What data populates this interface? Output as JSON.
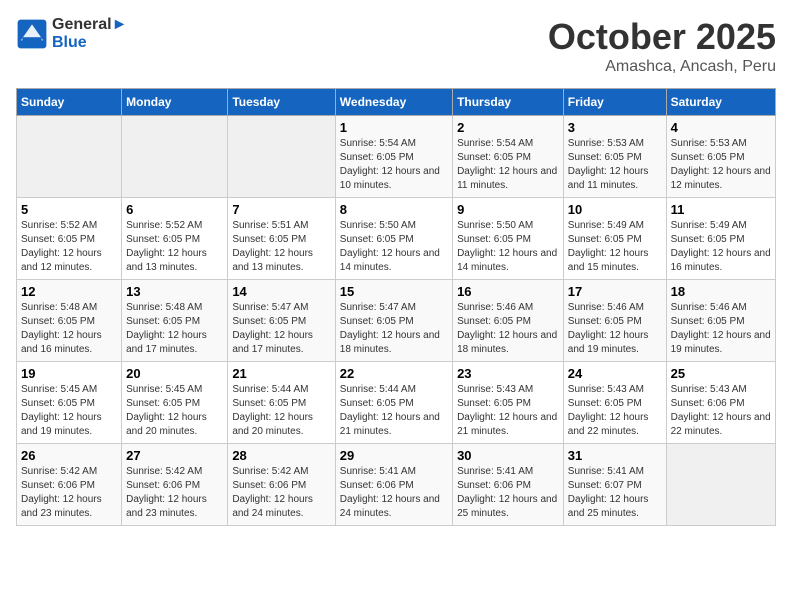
{
  "logo": {
    "line1": "General",
    "line2": "Blue"
  },
  "title": "October 2025",
  "subtitle": "Amashca, Ancash, Peru",
  "days_of_week": [
    "Sunday",
    "Monday",
    "Tuesday",
    "Wednesday",
    "Thursday",
    "Friday",
    "Saturday"
  ],
  "weeks": [
    [
      {
        "day": "",
        "sunrise": "",
        "sunset": "",
        "daylight": ""
      },
      {
        "day": "",
        "sunrise": "",
        "sunset": "",
        "daylight": ""
      },
      {
        "day": "",
        "sunrise": "",
        "sunset": "",
        "daylight": ""
      },
      {
        "day": "1",
        "sunrise": "Sunrise: 5:54 AM",
        "sunset": "Sunset: 6:05 PM",
        "daylight": "Daylight: 12 hours and 10 minutes."
      },
      {
        "day": "2",
        "sunrise": "Sunrise: 5:54 AM",
        "sunset": "Sunset: 6:05 PM",
        "daylight": "Daylight: 12 hours and 11 minutes."
      },
      {
        "day": "3",
        "sunrise": "Sunrise: 5:53 AM",
        "sunset": "Sunset: 6:05 PM",
        "daylight": "Daylight: 12 hours and 11 minutes."
      },
      {
        "day": "4",
        "sunrise": "Sunrise: 5:53 AM",
        "sunset": "Sunset: 6:05 PM",
        "daylight": "Daylight: 12 hours and 12 minutes."
      }
    ],
    [
      {
        "day": "5",
        "sunrise": "Sunrise: 5:52 AM",
        "sunset": "Sunset: 6:05 PM",
        "daylight": "Daylight: 12 hours and 12 minutes."
      },
      {
        "day": "6",
        "sunrise": "Sunrise: 5:52 AM",
        "sunset": "Sunset: 6:05 PM",
        "daylight": "Daylight: 12 hours and 13 minutes."
      },
      {
        "day": "7",
        "sunrise": "Sunrise: 5:51 AM",
        "sunset": "Sunset: 6:05 PM",
        "daylight": "Daylight: 12 hours and 13 minutes."
      },
      {
        "day": "8",
        "sunrise": "Sunrise: 5:50 AM",
        "sunset": "Sunset: 6:05 PM",
        "daylight": "Daylight: 12 hours and 14 minutes."
      },
      {
        "day": "9",
        "sunrise": "Sunrise: 5:50 AM",
        "sunset": "Sunset: 6:05 PM",
        "daylight": "Daylight: 12 hours and 14 minutes."
      },
      {
        "day": "10",
        "sunrise": "Sunrise: 5:49 AM",
        "sunset": "Sunset: 6:05 PM",
        "daylight": "Daylight: 12 hours and 15 minutes."
      },
      {
        "day": "11",
        "sunrise": "Sunrise: 5:49 AM",
        "sunset": "Sunset: 6:05 PM",
        "daylight": "Daylight: 12 hours and 16 minutes."
      }
    ],
    [
      {
        "day": "12",
        "sunrise": "Sunrise: 5:48 AM",
        "sunset": "Sunset: 6:05 PM",
        "daylight": "Daylight: 12 hours and 16 minutes."
      },
      {
        "day": "13",
        "sunrise": "Sunrise: 5:48 AM",
        "sunset": "Sunset: 6:05 PM",
        "daylight": "Daylight: 12 hours and 17 minutes."
      },
      {
        "day": "14",
        "sunrise": "Sunrise: 5:47 AM",
        "sunset": "Sunset: 6:05 PM",
        "daylight": "Daylight: 12 hours and 17 minutes."
      },
      {
        "day": "15",
        "sunrise": "Sunrise: 5:47 AM",
        "sunset": "Sunset: 6:05 PM",
        "daylight": "Daylight: 12 hours and 18 minutes."
      },
      {
        "day": "16",
        "sunrise": "Sunrise: 5:46 AM",
        "sunset": "Sunset: 6:05 PM",
        "daylight": "Daylight: 12 hours and 18 minutes."
      },
      {
        "day": "17",
        "sunrise": "Sunrise: 5:46 AM",
        "sunset": "Sunset: 6:05 PM",
        "daylight": "Daylight: 12 hours and 19 minutes."
      },
      {
        "day": "18",
        "sunrise": "Sunrise: 5:46 AM",
        "sunset": "Sunset: 6:05 PM",
        "daylight": "Daylight: 12 hours and 19 minutes."
      }
    ],
    [
      {
        "day": "19",
        "sunrise": "Sunrise: 5:45 AM",
        "sunset": "Sunset: 6:05 PM",
        "daylight": "Daylight: 12 hours and 19 minutes."
      },
      {
        "day": "20",
        "sunrise": "Sunrise: 5:45 AM",
        "sunset": "Sunset: 6:05 PM",
        "daylight": "Daylight: 12 hours and 20 minutes."
      },
      {
        "day": "21",
        "sunrise": "Sunrise: 5:44 AM",
        "sunset": "Sunset: 6:05 PM",
        "daylight": "Daylight: 12 hours and 20 minutes."
      },
      {
        "day": "22",
        "sunrise": "Sunrise: 5:44 AM",
        "sunset": "Sunset: 6:05 PM",
        "daylight": "Daylight: 12 hours and 21 minutes."
      },
      {
        "day": "23",
        "sunrise": "Sunrise: 5:43 AM",
        "sunset": "Sunset: 6:05 PM",
        "daylight": "Daylight: 12 hours and 21 minutes."
      },
      {
        "day": "24",
        "sunrise": "Sunrise: 5:43 AM",
        "sunset": "Sunset: 6:05 PM",
        "daylight": "Daylight: 12 hours and 22 minutes."
      },
      {
        "day": "25",
        "sunrise": "Sunrise: 5:43 AM",
        "sunset": "Sunset: 6:06 PM",
        "daylight": "Daylight: 12 hours and 22 minutes."
      }
    ],
    [
      {
        "day": "26",
        "sunrise": "Sunrise: 5:42 AM",
        "sunset": "Sunset: 6:06 PM",
        "daylight": "Daylight: 12 hours and 23 minutes."
      },
      {
        "day": "27",
        "sunrise": "Sunrise: 5:42 AM",
        "sunset": "Sunset: 6:06 PM",
        "daylight": "Daylight: 12 hours and 23 minutes."
      },
      {
        "day": "28",
        "sunrise": "Sunrise: 5:42 AM",
        "sunset": "Sunset: 6:06 PM",
        "daylight": "Daylight: 12 hours and 24 minutes."
      },
      {
        "day": "29",
        "sunrise": "Sunrise: 5:41 AM",
        "sunset": "Sunset: 6:06 PM",
        "daylight": "Daylight: 12 hours and 24 minutes."
      },
      {
        "day": "30",
        "sunrise": "Sunrise: 5:41 AM",
        "sunset": "Sunset: 6:06 PM",
        "daylight": "Daylight: 12 hours and 25 minutes."
      },
      {
        "day": "31",
        "sunrise": "Sunrise: 5:41 AM",
        "sunset": "Sunset: 6:07 PM",
        "daylight": "Daylight: 12 hours and 25 minutes."
      },
      {
        "day": "",
        "sunrise": "",
        "sunset": "",
        "daylight": ""
      }
    ]
  ]
}
